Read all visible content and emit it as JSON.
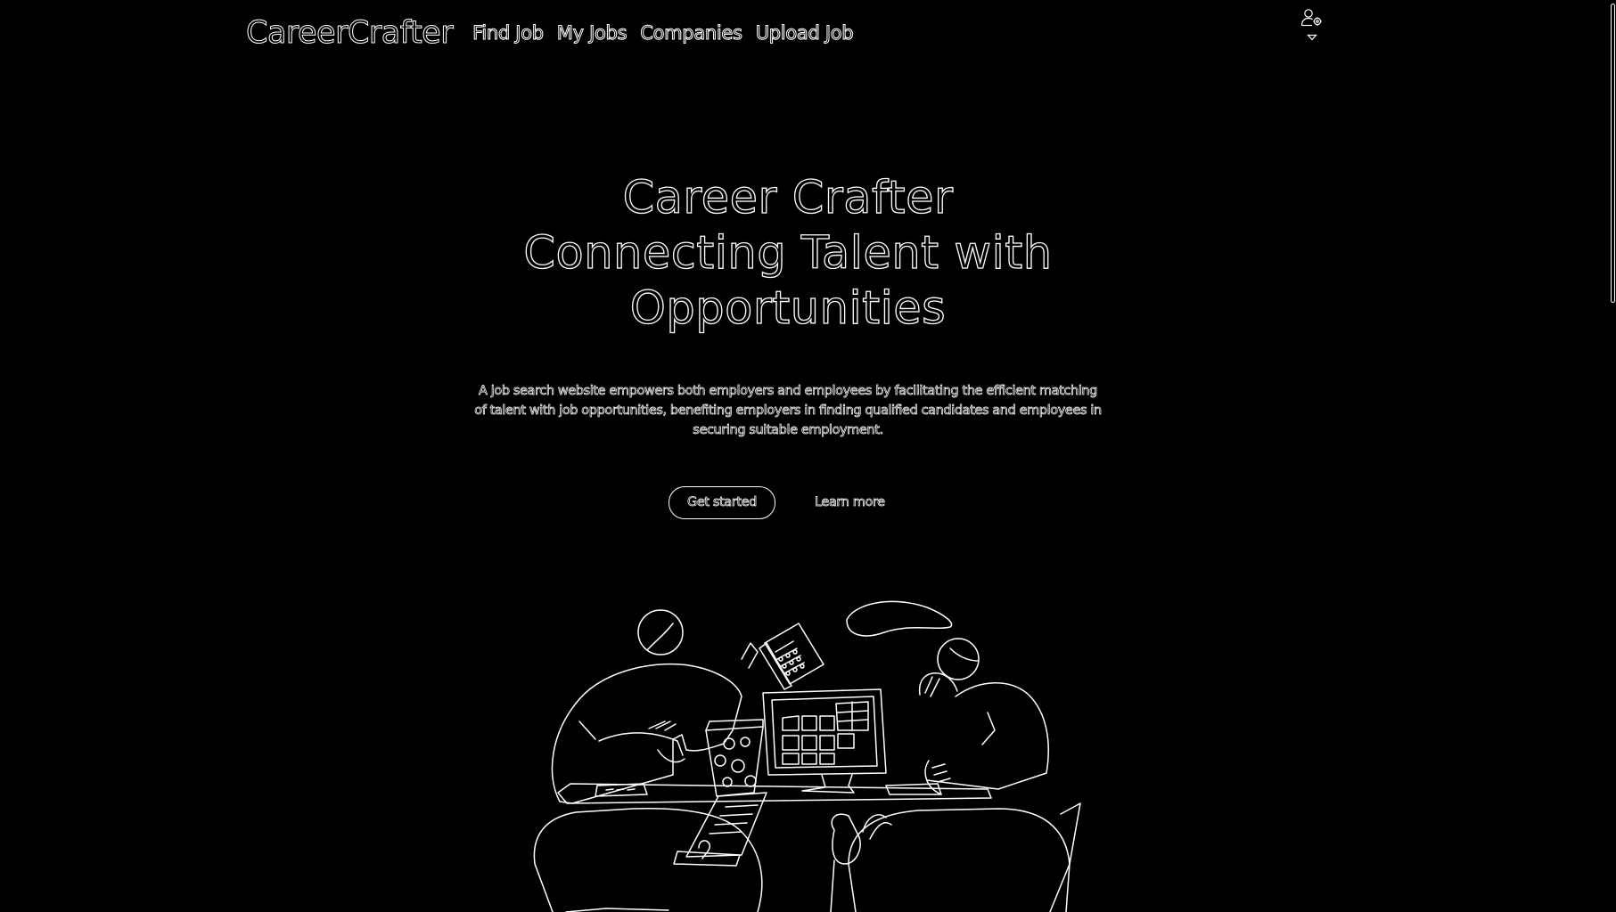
{
  "navbar": {
    "brand": "CareerCrafter",
    "links": [
      "Find Job",
      "My Jobs",
      "Companies",
      "Upload Job"
    ],
    "user_icon": "user-gear-icon",
    "dropdown_icon": "caret-down-icon"
  },
  "hero": {
    "title_line1": "Career Crafter",
    "title_line2": "Connecting Talent with",
    "title_line3": "Opportunities",
    "description": "A job search website empowers both employers and employees by facilitating the efficient matching of talent with job opportunities, benefiting employers in finding qualified candidates and employees in securing suitable employment.",
    "primary_cta": "Get started",
    "secondary_cta": "Learn more"
  },
  "illustration": {
    "icon": "people-at-desk-illustration"
  },
  "colors": {
    "background": "#000000",
    "stroke": "#ffffff"
  }
}
